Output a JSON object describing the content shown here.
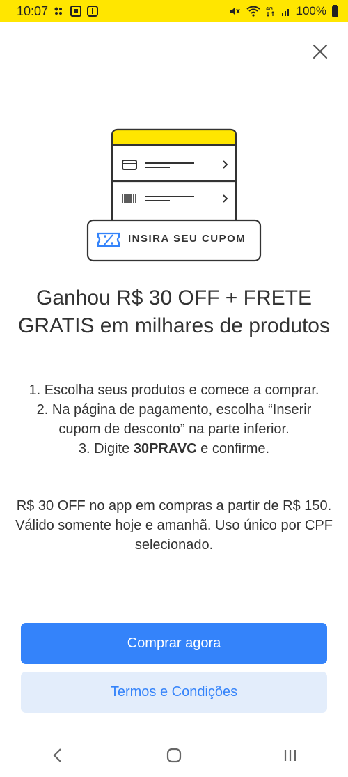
{
  "status_bar": {
    "time": "10:07",
    "battery": "100%"
  },
  "dialog": {
    "close_icon": "close-icon",
    "illustration": {
      "coupon_label": "INSIRA SEU CUPOM",
      "accent_color": "#FFE600",
      "coupon_icon_color": "#3483FA"
    },
    "headline": "Ganhou R$ 30 OFF + FRETE GRATIS em milhares de produtos",
    "steps": {
      "line1": "1. Escolha seus produtos e comece a comprar.",
      "line2": "2. Na página de pagamento, escolha “Inserir cupom de desconto” na parte inferior.",
      "line3_prefix": "3. Digite ",
      "line3_code": "30PRAVC",
      "line3_suffix": " e confirme."
    },
    "terms_text": "R$ 30 OFF no app em compras a partir de R$ 150. Válido somente hoje e amanhã. Uso único por CPF selecionado.",
    "primary_button": "Comprar agora",
    "secondary_button": "Termos e Condições",
    "colors": {
      "primary": "#3483FA",
      "secondary_bg": "#E3EDFB"
    }
  },
  "nav_bar": {
    "back_icon": "back-icon",
    "home_icon": "home-icon",
    "recents_icon": "recents-icon"
  }
}
